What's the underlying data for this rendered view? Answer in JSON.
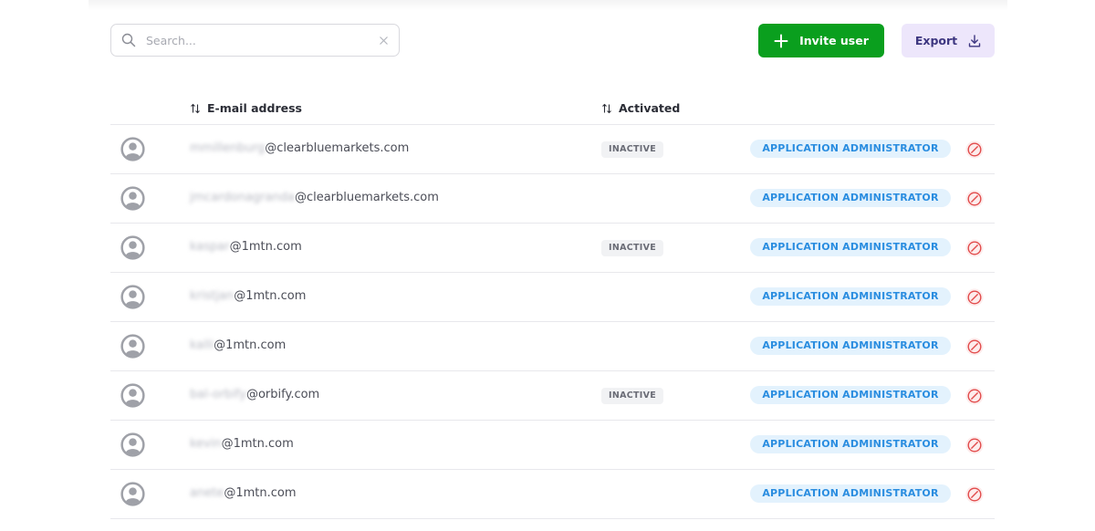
{
  "toolbar": {
    "search_placeholder": "Search...",
    "search_value": "",
    "invite_label": "Invite user",
    "export_label": "Export",
    "icons": {
      "search": "search-icon",
      "clear": "close-icon",
      "invite": "plus-icon",
      "export": "download-icon"
    },
    "colors": {
      "invite_bg": "#0a9f1e",
      "export_bg": "#ede6fb",
      "export_text": "#3d3680"
    }
  },
  "table": {
    "columns": {
      "email": "E-mail address",
      "activated": "Activated"
    },
    "rows": [
      {
        "email_local": "mmillenburg",
        "email_domain": "@clearbluemarkets.com",
        "status": "INACTIVE",
        "role": "APPLICATION ADMINISTRATOR"
      },
      {
        "email_local": "jmcardonagranda",
        "email_domain": "@clearbluemarkets.com",
        "status": "",
        "role": "APPLICATION ADMINISTRATOR"
      },
      {
        "email_local": "kaspar",
        "email_domain": "@1mtn.com",
        "status": "INACTIVE",
        "role": "APPLICATION ADMINISTRATOR"
      },
      {
        "email_local": "kristjan",
        "email_domain": "@1mtn.com",
        "status": "",
        "role": "APPLICATION ADMINISTRATOR"
      },
      {
        "email_local": "kalli",
        "email_domain": "@1mtn.com",
        "status": "",
        "role": "APPLICATION ADMINISTRATOR"
      },
      {
        "email_local": "bal-orbify",
        "email_domain": "@orbify.com",
        "status": "INACTIVE",
        "role": "APPLICATION ADMINISTRATOR"
      },
      {
        "email_local": "kevin",
        "email_domain": "@1mtn.com",
        "status": "",
        "role": "APPLICATION ADMINISTRATOR"
      },
      {
        "email_local": "anete",
        "email_domain": "@1mtn.com",
        "status": "",
        "role": "APPLICATION ADMINISTRATOR"
      }
    ],
    "icons": {
      "avatar": "user-avatar-icon",
      "remove": "remove-circle-icon",
      "sort": "sort-icon"
    },
    "colors": {
      "role_bg": "#e3f2fd",
      "role_text": "#2a8de0",
      "remove": "#e24b4b"
    }
  }
}
